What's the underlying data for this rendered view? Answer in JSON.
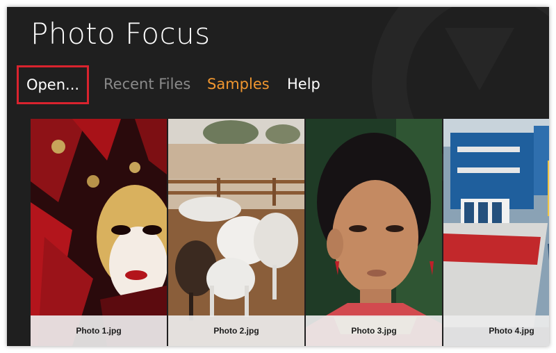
{
  "app": {
    "title": "Photo Focus"
  },
  "nav": {
    "items": [
      {
        "label": "Open...",
        "highlighted": true
      },
      {
        "label": "Recent Files"
      },
      {
        "label": "Samples"
      },
      {
        "label": "Help"
      }
    ]
  },
  "colors": {
    "background": "#1f1f1f",
    "highlight_border": "#d9232e",
    "samples_accent": "#f0962f",
    "muted_text": "#8a8a8a"
  },
  "gallery": {
    "photos": [
      {
        "caption": "Photo 1.jpg"
      },
      {
        "caption": "Photo 2.jpg"
      },
      {
        "caption": "Photo 3.jpg"
      },
      {
        "caption": "Photo 4.jpg"
      }
    ]
  }
}
